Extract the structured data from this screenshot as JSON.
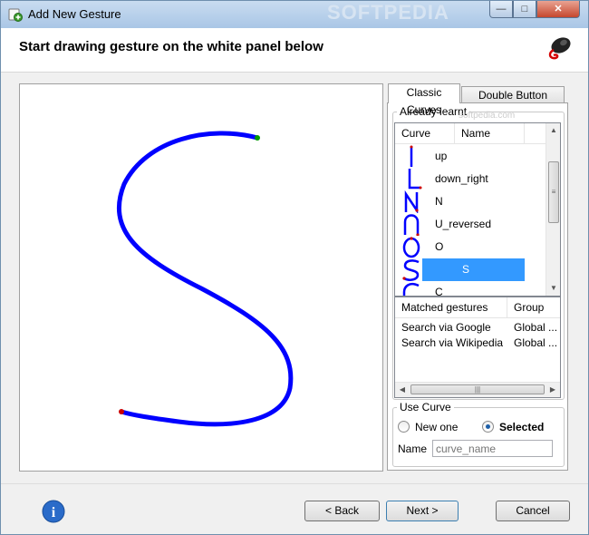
{
  "window": {
    "title": "Add New Gesture",
    "watermark": "SOFTPEDIA"
  },
  "window_controls": {
    "minimize": "—",
    "maximize": "□",
    "close": "✕"
  },
  "header": {
    "instruction": "Start drawing gesture on the white panel below"
  },
  "gesture": {
    "stroke_color": "#0000ff",
    "start_marker_color": "#009900",
    "end_marker_color": "#cc0000"
  },
  "tabs": [
    {
      "label": "Classic Curves",
      "active": true
    },
    {
      "label": "Double Button Combo",
      "active": false
    }
  ],
  "already_learnt": {
    "label": "Already learnt",
    "watermark": "softpedia.com",
    "columns": [
      "Curve",
      "Name"
    ],
    "rows": [
      {
        "curve": "up",
        "name": "up"
      },
      {
        "curve": "down_right",
        "name": "down_right"
      },
      {
        "curve": "N",
        "name": "N"
      },
      {
        "curve": "U_reversed",
        "name": "U_reversed"
      },
      {
        "curve": "O",
        "name": "O"
      },
      {
        "curve": "S",
        "name": "S",
        "selected": true
      },
      {
        "curve": "C",
        "name": "C"
      }
    ],
    "scrollbar": {
      "up": "▲",
      "down": "▼",
      "grip": "≡"
    }
  },
  "matched_gestures": {
    "columns": [
      "Matched gestures",
      "Group"
    ],
    "rows": [
      {
        "gesture": "Search via Google",
        "group": "Global ..."
      },
      {
        "gesture": "Search via Wikipedia",
        "group": "Global ..."
      }
    ],
    "scrollbar": {
      "left": "◀",
      "right": "▶",
      "grip": "|||"
    }
  },
  "use_curve": {
    "label": "Use Curve",
    "options": [
      {
        "label": "New  one",
        "selected": false
      },
      {
        "label": "Selected",
        "selected": true
      }
    ],
    "name_label": "Name",
    "name_placeholder": "curve_name"
  },
  "footer": {
    "info_icon": "i",
    "back": "< Back",
    "next": "Next >",
    "cancel": "Cancel"
  },
  "colors": {
    "accent_selection": "#3399ff",
    "stroke": "#0000ff"
  }
}
